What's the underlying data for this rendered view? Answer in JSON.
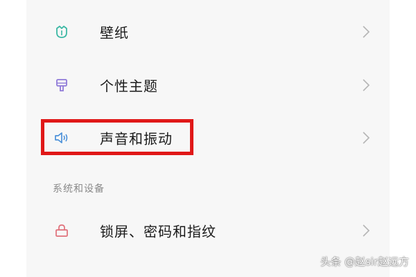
{
  "settings": {
    "items": [
      {
        "label": "壁纸",
        "icon": "tulip-icon",
        "color": "#3bb8a4"
      },
      {
        "label": "个性主题",
        "icon": "paint-brush-icon",
        "color": "#8f7ad8"
      },
      {
        "label": "声音和振动",
        "icon": "speaker-icon",
        "color": "#4a90d9"
      }
    ],
    "section_title": "系统和设备",
    "section_items": [
      {
        "label": "锁屏、密码和指纹",
        "icon": "lock-icon",
        "color": "#e0707a"
      }
    ]
  },
  "highlight": {
    "color": "#e01818",
    "target": "声音和振动"
  },
  "watermark": "头条 @赵sir赵远方"
}
